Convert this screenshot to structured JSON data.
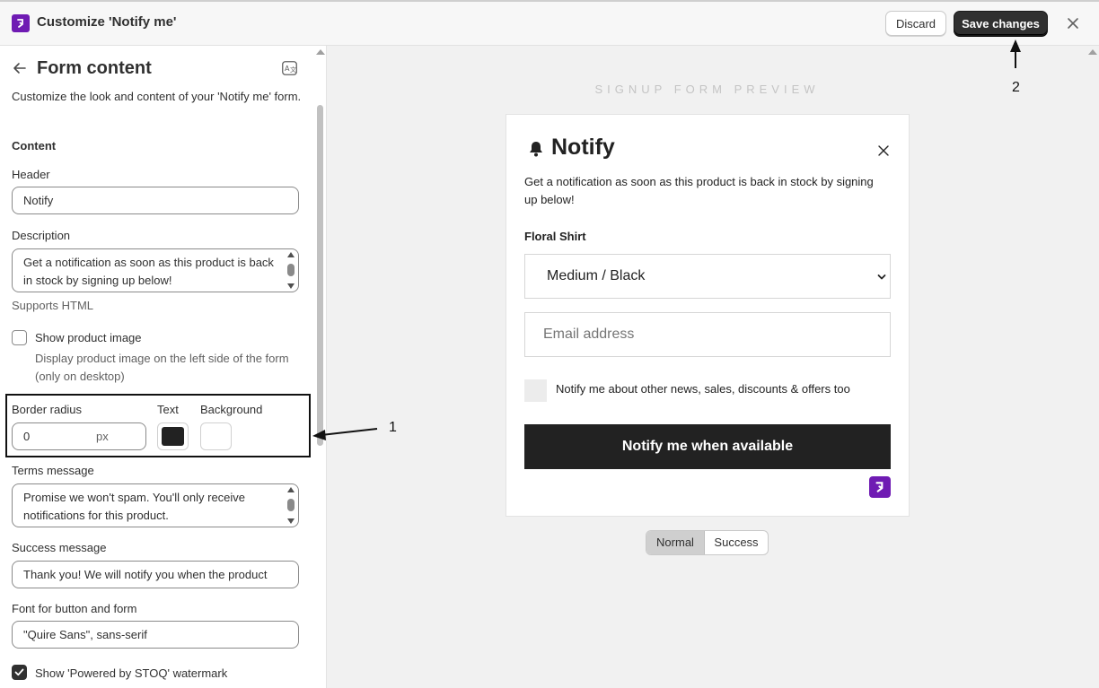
{
  "topbar": {
    "title": "Customize 'Notify me'",
    "discard_label": "Discard",
    "save_label": "Save changes"
  },
  "panel": {
    "title": "Form content",
    "description": "Customize the look and content of your 'Notify me' form.",
    "section_content": "Content",
    "header_label": "Header",
    "header_value": "Notify",
    "description_label": "Description",
    "description_value": "Get a notification as soon as this product is back in stock by signing up below!",
    "supports_html": "Supports HTML",
    "show_image_label": "Show product image",
    "show_image_checked": false,
    "show_image_help": "Display product image on the left side of the form (only on desktop)",
    "border_radius_label": "Border radius",
    "border_radius_value": "0",
    "border_radius_unit": "px",
    "text_label": "Text",
    "text_color": "#222222",
    "background_label": "Background",
    "background_color": "#ffffff",
    "terms_label": "Terms message",
    "terms_value": "Promise we won't spam. You'll only receive notifications for this product.",
    "success_label": "Success message",
    "success_value": "Thank you! We will notify you when the product",
    "font_label": "Font for button and form",
    "font_value": "\"Quire Sans\", sans-serif",
    "watermark_label": "Show 'Powered by STOQ' watermark",
    "watermark_checked": true
  },
  "preview": {
    "label": "SIGNUP FORM PREVIEW",
    "form_title": "Notify",
    "form_description": "Get a notification as soon as this product is back in stock by signing up below!",
    "product_name": "Floral Shirt",
    "variant": "Medium / Black",
    "email_placeholder": "Email address",
    "newsletter_label": "Notify me about other news, sales, discounts & offers too",
    "button_label": "Notify me when available",
    "toggle_normal": "Normal",
    "toggle_success": "Success",
    "toggle_selected": "Normal"
  },
  "annotations": {
    "one": "1",
    "two": "2"
  },
  "colors": {
    "brand": "#6f1bb3",
    "primary_button": "#303030",
    "form_button": "#222222"
  },
  "icons": [
    "app-logo-icon",
    "close-icon",
    "arrow-left-icon",
    "translate-icon",
    "bell-icon",
    "chevron-down-icon",
    "checkmark-icon"
  ]
}
